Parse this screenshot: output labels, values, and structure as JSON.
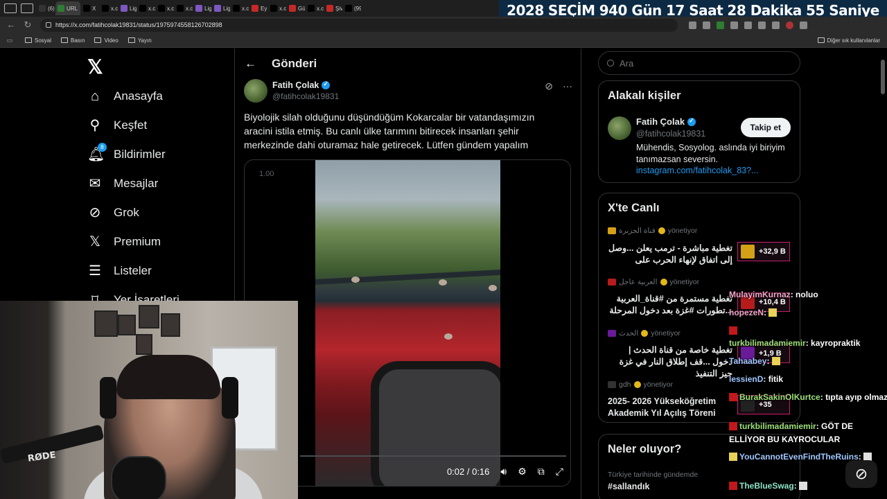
{
  "browser": {
    "tabs": [
      {
        "label": "(6) A",
        "color": "#333"
      },
      {
        "label": "URL",
        "color": "#2e7d32",
        "active": true
      },
      {
        "label": "X",
        "color": "#000"
      },
      {
        "label": "x.co",
        "color": "#000"
      },
      {
        "label": "Ligh",
        "color": "#7e57c2"
      },
      {
        "label": "x.co",
        "color": "#000"
      },
      {
        "label": "x.co",
        "color": "#000"
      },
      {
        "label": "x.co",
        "color": "#000"
      },
      {
        "label": "Ligh",
        "color": "#7e57c2"
      },
      {
        "label": "Ligh",
        "color": "#7e57c2"
      },
      {
        "label": "x.co",
        "color": "#000"
      },
      {
        "label": "Ey T",
        "color": "#c62828"
      },
      {
        "label": "x.co",
        "color": "#000"
      },
      {
        "label": "Gün",
        "color": "#c62828"
      },
      {
        "label": "x.co",
        "color": "#000"
      },
      {
        "label": "Şiva",
        "color": "#c62828"
      },
      {
        "label": "(99-",
        "color": "#000"
      }
    ],
    "url": "https://x.com/fatihcolak19831/status/1975974558126702898",
    "bookmarks": [
      "Sosyal",
      "Basın",
      "Video",
      "Yayın"
    ],
    "other_bookmarks": "Diğer sık kullanılanlar"
  },
  "countdown": {
    "year": "2028",
    "election": "SEÇİM",
    "days": "940 Gün",
    "hours": "17 Saat",
    "minutes": "28 Dakika",
    "seconds": "55 Saniye"
  },
  "sidebar": {
    "items": [
      {
        "label": "Anasayfa",
        "icon": "home-icon"
      },
      {
        "label": "Keşfet",
        "icon": "search-icon"
      },
      {
        "label": "Bildirimler",
        "icon": "bell-icon",
        "badge": "8"
      },
      {
        "label": "Mesajlar",
        "icon": "mail-icon"
      },
      {
        "label": "Grok",
        "icon": "grok-icon"
      },
      {
        "label": "Premium",
        "icon": "x-logo-icon"
      },
      {
        "label": "Listeler",
        "icon": "list-icon"
      },
      {
        "label": "Yer İşaretleri",
        "icon": "bookmark-icon"
      }
    ]
  },
  "post": {
    "header_title": "Gönderi",
    "author_name": "Fatih Çolak",
    "author_handle": "@fatihcolak19831",
    "text": "Biyolojik silah olduğunu düşündüğüm Kokarcalar bir vatandaşımızın aracini istila etmiş. Bu canlı ülke tarımını bitirecek insanları şehir merkezinde dahi oturamaz hale getirecek. Lütfen gündem yapalım",
    "video": {
      "speed": "1.00",
      "time": "0:02 / 0:16"
    }
  },
  "right": {
    "search_placeholder": "Ara",
    "related_title": "Alakalı kişiler",
    "related": {
      "name": "Fatih Çolak",
      "handle": "@fatihcolak19831",
      "follow_label": "Takip et",
      "bio": "Mühendis, Sosyolog. aslında iyi biriyim tanımazsan seversin.",
      "link": "instagram.com/fatihcolak_83?..."
    },
    "live_title": "X'te Canlı",
    "live": [
      {
        "host": "قناة الجزيرة",
        "status": "yönetiyor",
        "title": "تغطية مباشرة - ترمب يعلن ...وصل إلى اتفاق لإنهاء الحرب على",
        "count": "+32,9 B",
        "thumb_color": "#d4a017"
      },
      {
        "host": "العربية عاجل",
        "status": "yönetiyor",
        "title": "تغطية مستمرة من #قناة_العربية ...تطورات #غزة بعد دخول المرحلة",
        "count": "+10,4 B",
        "thumb_color": "#b71c1c"
      },
      {
        "host": "الحدث",
        "status": "yönetiyor",
        "title": "تغطية خاصة من قناة الحدث | دخول ...قف إطلاق النار في غزة حيز التنفيذ",
        "count": "+1,9 B",
        "thumb_color": "#6a1b9a"
      },
      {
        "host": "gdh",
        "status": "yönetiyor",
        "title": "2025- 2026 Yükseköğretim Akademik Yıl Açılış Töreni",
        "count": "+35",
        "thumb_color": "#222222"
      }
    ],
    "trends_title": "Neler oluyor?",
    "trend_sub": "Türkiye tarihinde gündemde",
    "trend_tag": "#sallandık"
  },
  "stream": {
    "mic_brand": "RØDE",
    "chat": [
      {
        "user": "MulayimKurnaz",
        "msg": "noluo",
        "color": "pink"
      },
      {
        "user": "hopezeN",
        "msg": "",
        "color": "pink"
      },
      {
        "user": "turkbilimadamiemir",
        "msg": "kayropraktik",
        "color": "green"
      },
      {
        "user": "Tahaabey",
        "msg": "",
        "color": "blue"
      },
      {
        "user": "lessienD",
        "msg": "fitik",
        "color": "blue"
      },
      {
        "user": "BurakSakinOlKurtce",
        "msg": "tıpta ayıp olmaz",
        "color": "green"
      },
      {
        "user": "turkbilimadamiemir",
        "msg": "GÖT DE ELLİYOR BU KAYROCULAR",
        "color": "green"
      },
      {
        "user": "YouCannotEvenFindTheRuins",
        "msg": "",
        "color": "blue"
      },
      {
        "user": "TheBlueSwag",
        "msg": "",
        "color": "teal"
      }
    ]
  }
}
